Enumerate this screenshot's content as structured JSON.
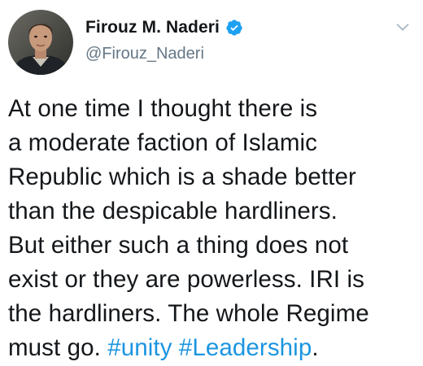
{
  "author": {
    "display_name": "Firouz M. Naderi",
    "handle": "@Firouz_Naderi",
    "verified": true,
    "avatar_icon": "profile-photo"
  },
  "tweet": {
    "text_lines": [
      "At one time I thought there is",
      "a moderate faction of Islamic",
      "Republic which is a shade better",
      "than the despicable hardliners.",
      "But either such a thing does not",
      "exist or they are powerless. IRI is",
      "the hardliners. The whole Regime"
    ],
    "last_line_prefix": "must go. ",
    "hashtag_1": "#unity",
    "space": " ",
    "hashtag_2": "#Leadership",
    "last_line_suffix": "."
  },
  "icons": {
    "verified": "verified-badge-icon",
    "menu": "chevron-down-icon"
  },
  "colors": {
    "text": "#14171a",
    "secondary_text": "#657786",
    "link": "#1b95e0",
    "verified": "#1da1f2",
    "background": "#ffffff"
  }
}
